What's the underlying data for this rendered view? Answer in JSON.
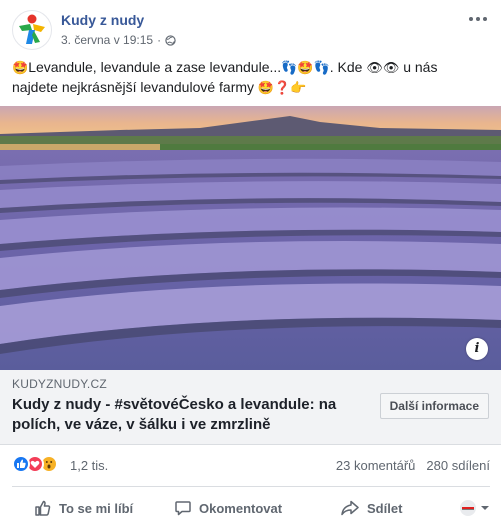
{
  "post": {
    "page_name": "Kudy z nudy",
    "timestamp": "3. června v 19:15",
    "separator": "·",
    "text_line1_a": "Levandule, levandule a zase levandule...",
    "text_line1_b": ". Kde",
    "text_line1_c": "u nás",
    "text_line2": "najdete nejkrásnější levandulové farmy",
    "icons": [
      "star-struck-emoji",
      "footprints-emoji",
      "eyes-emoji",
      "question-mark-emoji",
      "pointing-hand-emoji",
      "globe-icon",
      "more-icon",
      "info-icon"
    ]
  },
  "link_preview": {
    "domain": "KUDYZNUDY.CZ",
    "title": "Kudy z nudy - #světovéČesko a levandule: na polích, ve váze, v šálku i ve zmrzlině",
    "button_label": "Další informace"
  },
  "stats": {
    "reactions_count": "1,2 tis.",
    "comments": "23 komentářů",
    "shares": "280 sdílení",
    "reaction_types": [
      "like",
      "love",
      "wow"
    ]
  },
  "actions": {
    "like": "To se mi líbí",
    "comment": "Okomentovat",
    "share": "Sdílet"
  },
  "colors": {
    "brand_blue": "#385898",
    "like_blue": "#1877f2",
    "love_red": "#f33e58",
    "wow_yellow": "#f7b125"
  }
}
